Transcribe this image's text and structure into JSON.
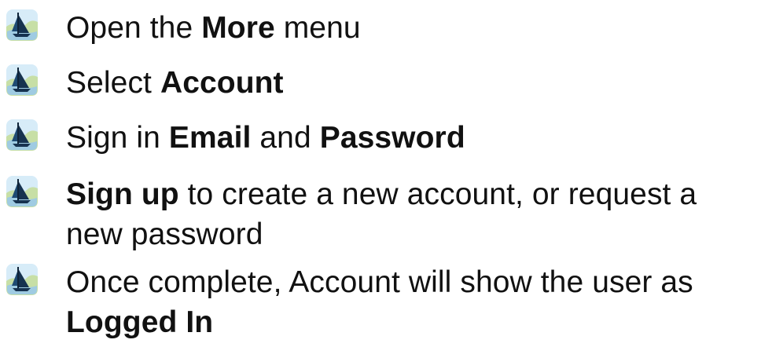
{
  "steps": [
    {
      "icon": "sailboat-icon",
      "before": "Open the ",
      "bold": "More",
      "after": " menu"
    },
    {
      "icon": "sailboat-icon",
      "before": "Select ",
      "bold": "Account",
      "after": ""
    },
    {
      "icon": "sailboat-icon",
      "before": "Sign in ",
      "bold": "Email",
      "middle": " and ",
      "bold2": "Password"
    },
    {
      "icon": "sailboat-icon",
      "bold": "Sign up",
      "after": " to create a new account, or request a new password"
    },
    {
      "icon": "sailboat-icon",
      "before": "Once complete, Account will show the user as ",
      "bold": "Logged In"
    }
  ],
  "colors": {
    "icon_sky": "#cfe7f5",
    "icon_land": "#c8e0a6",
    "icon_sail": "#16324f",
    "text": "#111111"
  }
}
